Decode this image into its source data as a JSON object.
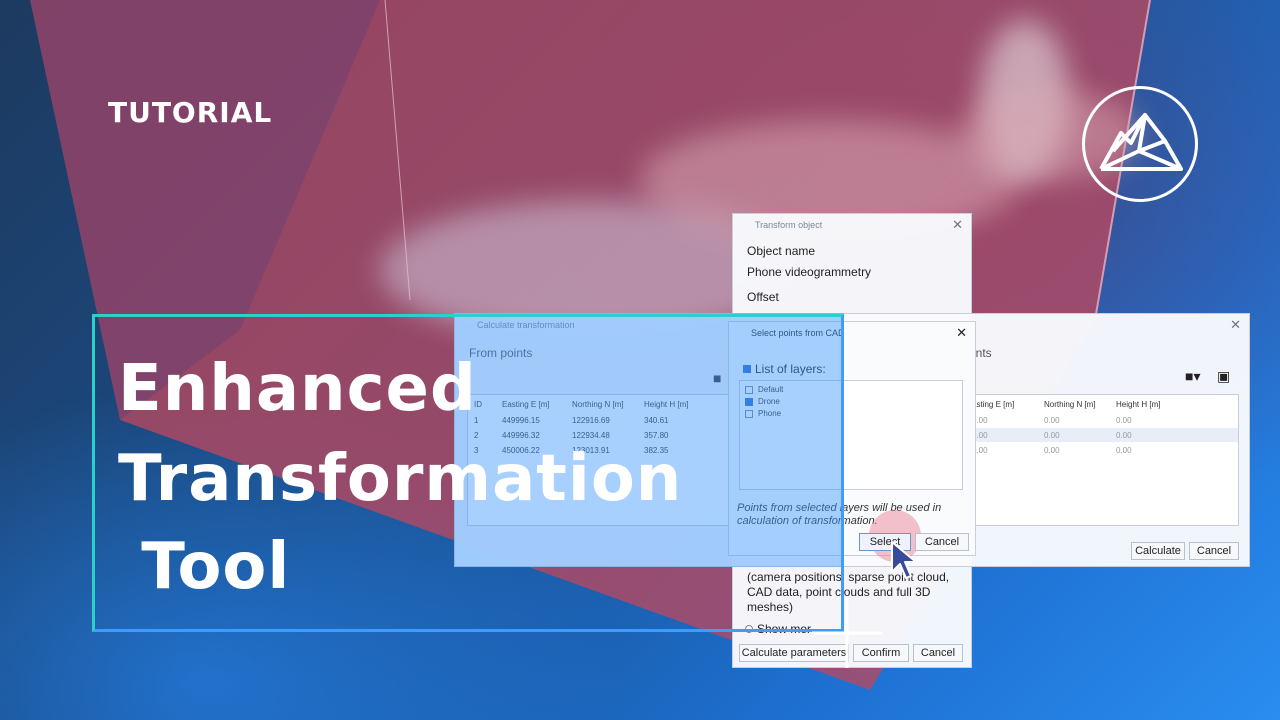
{
  "tag": "TUTORIAL",
  "title": {
    "line1": "Enhanced",
    "line2": "Transformation",
    "line3": " Tool"
  },
  "transform_window": {
    "title": "Transform object",
    "object_name_label": "Object name",
    "object_name_value": "Phone videogrammetry",
    "offset_label": "Offset",
    "description": [
      "(camera positions, sparse point cloud,",
      "CAD data, point clouds and full 3D",
      "meshes)"
    ],
    "show_more": "Show mor",
    "calc_params_button": "Calculate parameters",
    "confirm_button": "Confirm",
    "cancel_button": "Cancel"
  },
  "calc_window": {
    "title": "Calculate transformation",
    "from_points": "From points",
    "to_points": "ints",
    "columns": [
      "ID",
      "Easting E [m]",
      "Northing N [m]",
      "Height H [m]"
    ],
    "rows": [
      [
        "1",
        "449996.15",
        "122916.69",
        "340.61"
      ],
      [
        "2",
        "449996.32",
        "122934.48",
        "357.80"
      ],
      [
        "3",
        "450006.22",
        "123013.91",
        "382.35"
      ]
    ],
    "right_columns": [
      "asting E [m]",
      "Northing N [m]",
      "Height H [m]"
    ],
    "right_rows": [
      [
        "0.00",
        "0.00",
        "0.00"
      ],
      [
        "0.00",
        "0.00",
        "0.00"
      ],
      [
        "0.00",
        "0.00",
        "0.00"
      ]
    ],
    "calculate_button": "Calculate",
    "cancel_button": "Cancel"
  },
  "select_window": {
    "title": "Select points from CAD",
    "list_label": "List of layers:",
    "layers": [
      {
        "name": "Default",
        "checked": false
      },
      {
        "name": "Drone",
        "checked": true
      },
      {
        "name": "Phone",
        "checked": false
      }
    ],
    "note_line1": "Points from selected layers will be used in",
    "note_line2": "calculation of transformation.",
    "select_button": "Select",
    "cancel_button": "Cancel"
  },
  "colors": {
    "accent_teal": "#2cd0c8",
    "accent_blue": "#3f9cff",
    "plane_red": "#c0435f"
  }
}
